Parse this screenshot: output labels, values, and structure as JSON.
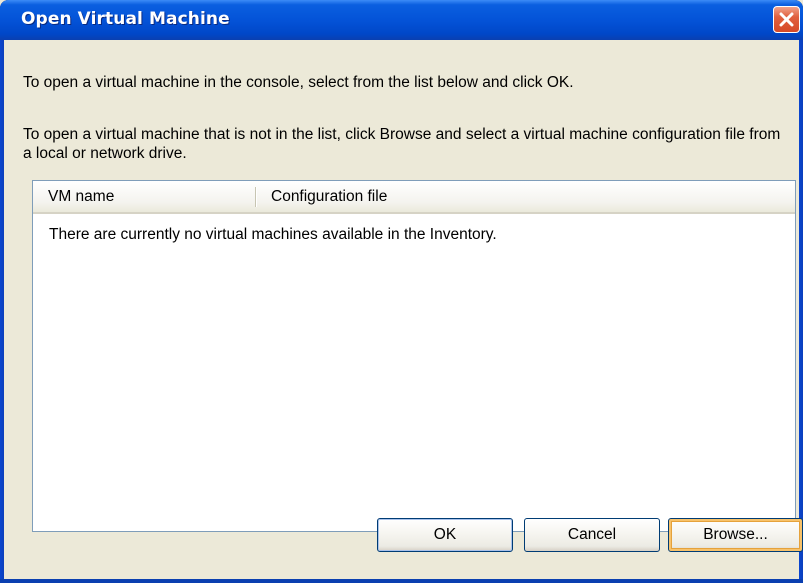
{
  "window": {
    "title": "Open Virtual Machine"
  },
  "instructions": {
    "line1": "To open a virtual machine in the console, select from the list below and click OK.",
    "line2": "To open a virtual machine that is not in the list, click Browse and select a virtual machine configuration file from a local or network drive."
  },
  "vm_list": {
    "columns": [
      "VM name",
      "Configuration file"
    ],
    "rows": [],
    "empty_message": "There are currently no virtual machines available in the Inventory."
  },
  "buttons": {
    "ok": "OK",
    "cancel": "Cancel",
    "browse": "Browse..."
  },
  "icons": {
    "close": "close-icon"
  },
  "colors": {
    "titlebar": "#0453d8",
    "close_button": "#d64a28",
    "dialog_background": "#ece9d8",
    "list_background": "#ffffff",
    "list_border": "#7f9db9",
    "focus_highlight": "#f7c26b"
  }
}
